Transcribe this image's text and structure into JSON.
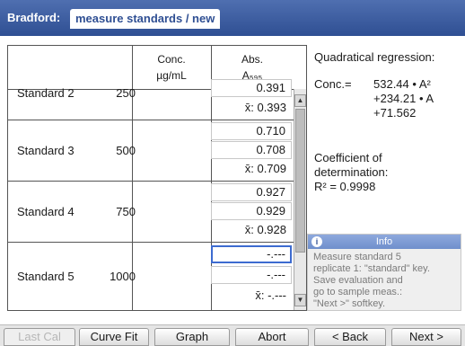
{
  "title": {
    "prefix": "Bradford:",
    "tab": "measure standards / new"
  },
  "table": {
    "headers": {
      "conc": [
        "Conc.",
        "µg/mL"
      ],
      "abs": [
        "Abs.",
        "A₅₉₅"
      ]
    },
    "rows": [
      {
        "name": "Standard  2",
        "conc": "250",
        "values": [
          "0.391"
        ],
        "mean": "x̄: 0.393"
      },
      {
        "name": "Standard  3",
        "conc": "500",
        "values": [
          "0.710",
          "0.708"
        ],
        "mean": "x̄: 0.709"
      },
      {
        "name": "Standard  4",
        "conc": "750",
        "values": [
          "0.927",
          "0.929"
        ],
        "mean": "x̄: 0.928"
      },
      {
        "name": "Standard  5",
        "conc": "1000",
        "values": [
          "-.---",
          "-.---"
        ],
        "mean": "x̄: -.---"
      }
    ]
  },
  "regression": {
    "title": "Quadratical regression:",
    "conc_label": "Conc.=",
    "line1": "532.44 • A²",
    "line2": "+234.21 • A",
    "line3": "+71.562",
    "coef_label1": "Coefficient of",
    "coef_label2": "determination:",
    "coef_value": "R² = 0.9998"
  },
  "info": {
    "header": "Info",
    "icon": "info-icon",
    "lines": [
      "Measure standard 5",
      "replicate 1: \"standard\" key.",
      "Save evaluation and",
      "go to sample meas.:",
      "\"Next >\" softkey."
    ]
  },
  "softkeys": [
    "Last Cal",
    "Curve Fit",
    "Graph",
    "Abort",
    "< Back",
    "Next >"
  ],
  "colors": {
    "accent": "#2f4f93",
    "active_border": "#3d6bd0",
    "disabled_text": "#b6b6b6"
  }
}
